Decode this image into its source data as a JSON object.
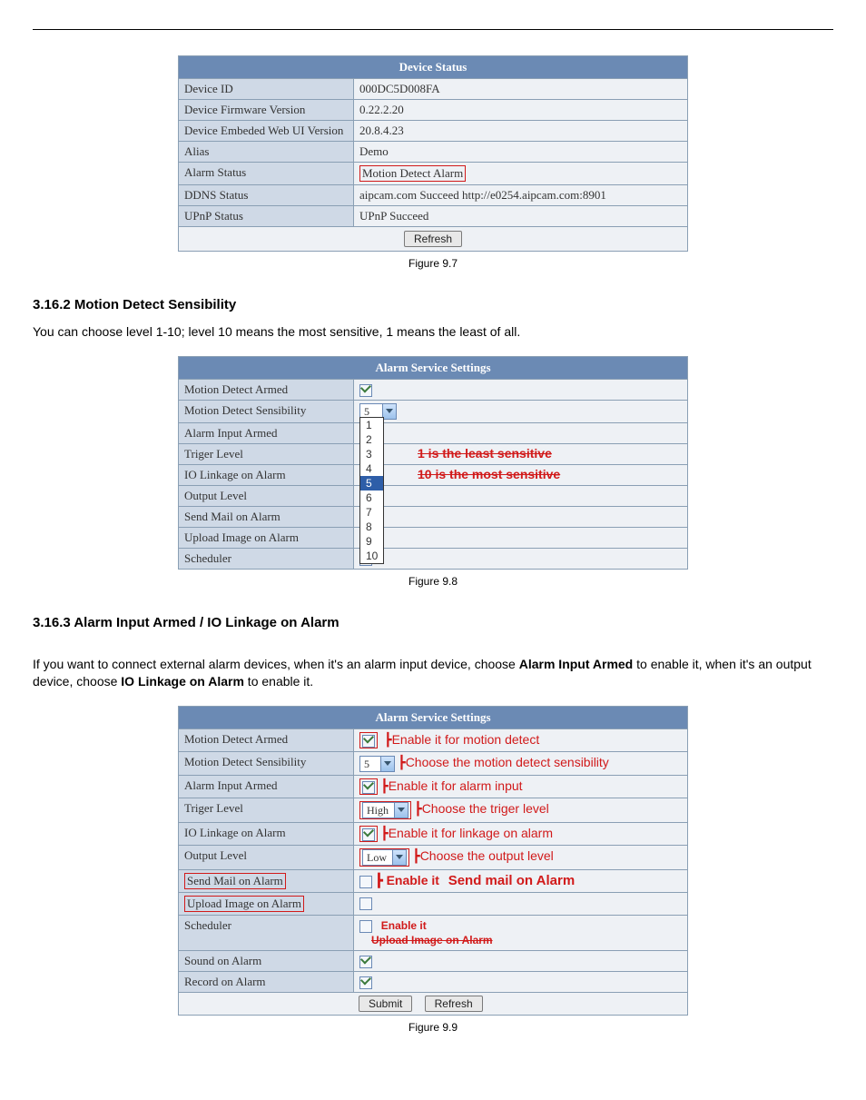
{
  "fig97": {
    "title": "Device Status",
    "rows": {
      "device_id_l": "Device ID",
      "device_id_v": "000DC5D008FA",
      "fw_l": "Device Firmware Version",
      "fw_v": "0.22.2.20",
      "web_l": "Device Embeded Web UI Version",
      "web_v": "20.8.4.23",
      "alias_l": "Alias",
      "alias_v": "Demo",
      "alarm_l": "Alarm Status",
      "alarm_v": "Motion Detect Alarm",
      "ddns_l": "DDNS Status",
      "ddns_v": "aipcam.com  Succeed  http://e0254.aipcam.com:8901",
      "upnp_l": "UPnP Status",
      "upnp_v": "UPnP Succeed"
    },
    "refresh": "Refresh",
    "caption": "Figure 9.7"
  },
  "sec162": {
    "heading": "3.16.2 Motion Detect Sensibility",
    "para": "You can choose level 1-10; level 10 means the most sensitive, 1 means the least of all."
  },
  "fig98": {
    "title": "Alarm Service Settings",
    "rows": {
      "mda_l": "Motion Detect Armed",
      "mds_l": "Motion Detect Sensibility",
      "mds_v": "5",
      "aia_l": "Alarm Input Armed",
      "trg_l": "Triger Level",
      "iol_l": "IO Linkage on Alarm",
      "out_l": "Output Level",
      "mail_l": "Send Mail on Alarm",
      "upimg_l": "Upload Image on Alarm",
      "sched_l": "Scheduler"
    },
    "options": [
      "1",
      "2",
      "3",
      "4",
      "5",
      "6",
      "7",
      "8",
      "9",
      "10"
    ],
    "annot1": "1 is the least sensitive",
    "annot2": "10 is the most sensitive",
    "caption": "Figure 9.8"
  },
  "sec163": {
    "heading": "3.16.3 Alarm Input Armed / IO Linkage on Alarm",
    "para1a": "If you want to connect external alarm devices, when it's an alarm input device, choose ",
    "para1b": "Alarm Input Armed",
    "para1c": " to enable it, when it's an output device, choose ",
    "para1d": "IO Linkage on Alarm",
    "para1e": " to enable it."
  },
  "fig99": {
    "title": "Alarm Service Settings",
    "rows": {
      "mda_l": "Motion Detect Armed",
      "mda_a": "Enable it for motion detect",
      "mds_l": "Motion Detect Sensibility",
      "mds_v": "5",
      "mds_a": "Choose the motion detect sensibility",
      "aia_l": "Alarm Input Armed",
      "aia_a": "Enable it for alarm input",
      "trg_l": "Triger Level",
      "trg_v": "High",
      "trg_a": "Choose the triger level",
      "iol_l": "IO Linkage on Alarm",
      "iol_a": "Enable it for linkage on alarm",
      "out_l": "Output Level",
      "out_v": "Low",
      "out_a": "Choose the output level",
      "mail_l": "Send Mail on Alarm",
      "mail_a": "Enable it",
      "mail_a2": "Send mail on Alarm",
      "upimg_l": "Upload Image on Alarm",
      "sched_l": "Scheduler",
      "sched_a1": "Enable it",
      "sched_a2": "Upload Image on Alarm",
      "snd_l": "Sound on Alarm",
      "rec_l": "Record on Alarm"
    },
    "submit": "Submit",
    "refresh": "Refresh",
    "caption": "Figure 9.9"
  }
}
